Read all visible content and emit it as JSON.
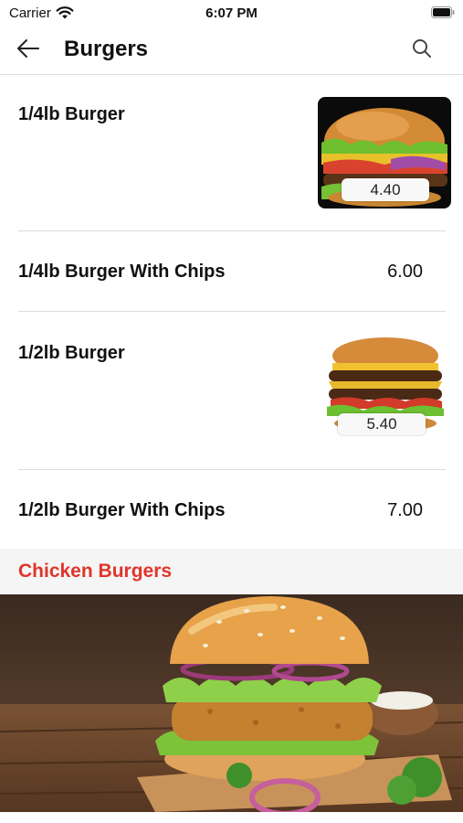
{
  "status_bar": {
    "carrier": "Carrier",
    "time": "6:07 PM"
  },
  "nav": {
    "title": "Burgers",
    "back_icon": "arrow-left-icon",
    "search_icon": "search-icon"
  },
  "items": [
    {
      "name": "1/4lb Burger",
      "price": "4.40",
      "has_image": true
    },
    {
      "name": "1/4lb Burger With Chips",
      "price": "6.00",
      "has_image": false
    },
    {
      "name": "1/2lb Burger",
      "price": "5.40",
      "has_image": true
    },
    {
      "name": "1/2lb Burger With Chips",
      "price": "7.00",
      "has_image": false
    }
  ],
  "section": {
    "title": "Chicken Burgers",
    "color": "#e0352b"
  }
}
